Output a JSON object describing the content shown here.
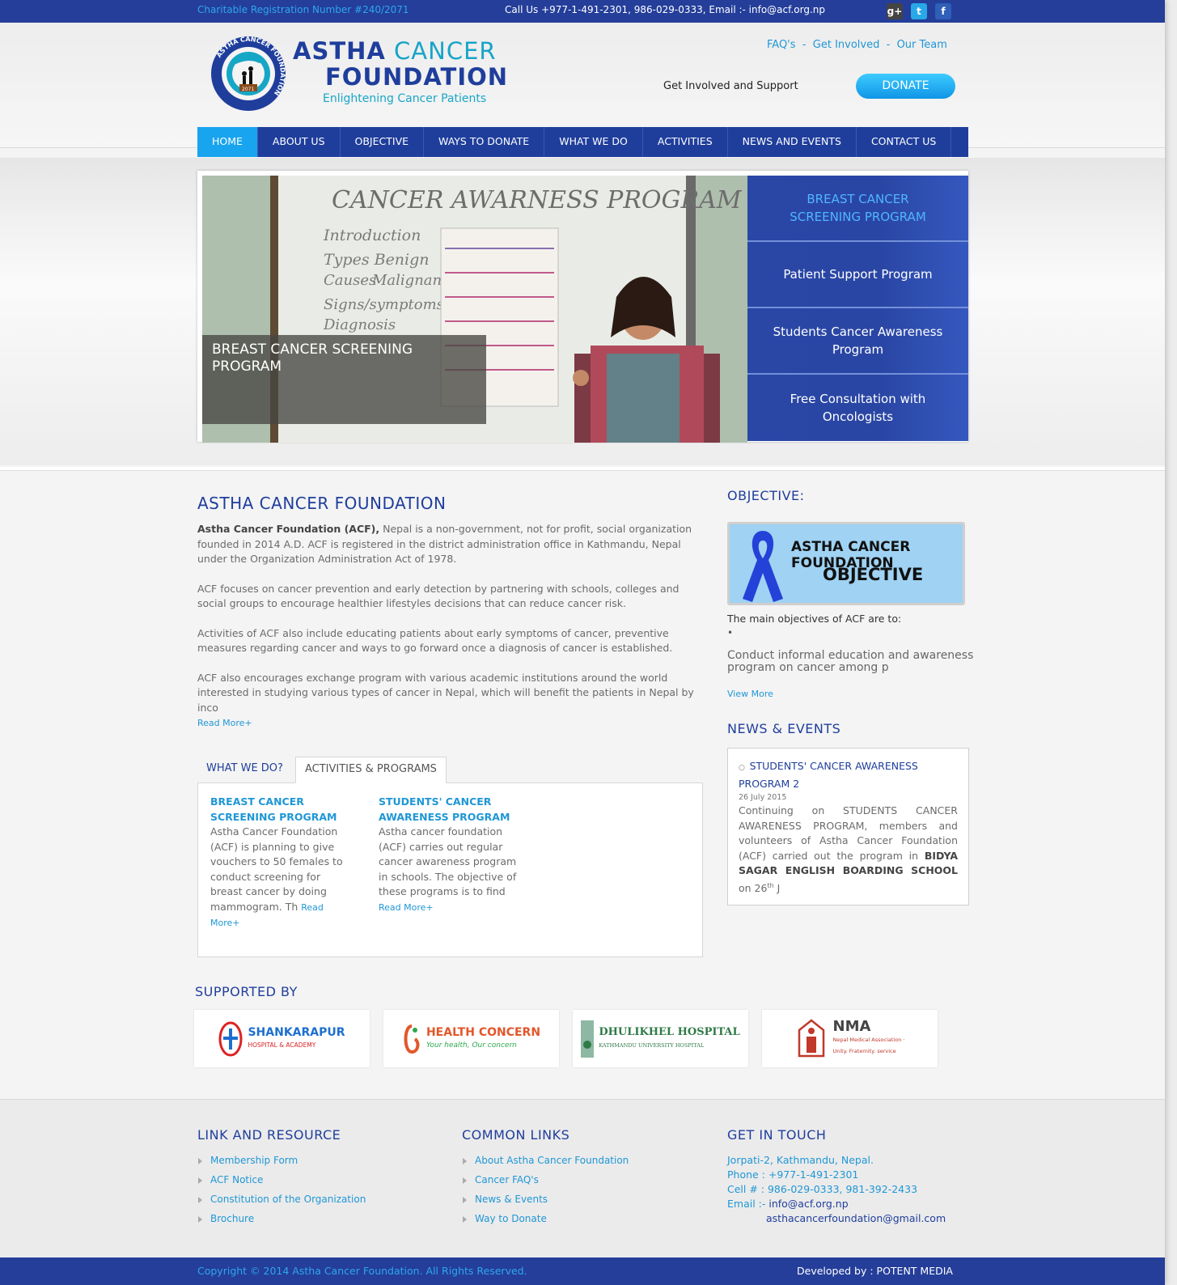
{
  "topbar": {
    "registration": "Charitable Registration Number #240/2071",
    "contact": "Call Us +977-1-491-2301, 986-029-0333, Email :- info@acf.org.np",
    "social": [
      "g+",
      "t",
      "f"
    ]
  },
  "brand": {
    "word1": "ASTHA",
    "word2": "CANCER",
    "word3": "FOUNDATION",
    "tagline": "Enlightening Cancer Patients",
    "logo_ring_text": "ASTHA CANCER FOUNDATION",
    "logo_year": "2071"
  },
  "header": {
    "links": [
      "FAQ's",
      "Get Involved",
      "Our Team"
    ],
    "separator": "-",
    "support_text": "Get Involved and Support",
    "donate_label": "DONATE"
  },
  "nav": {
    "items": [
      "HOME",
      "ABOUT US",
      "OBJECTIVE",
      "WAYS TO DONATE",
      "WHAT WE DO",
      "ACTIVITIES",
      "NEWS AND EVENTS",
      "CONTACT US"
    ]
  },
  "slider": {
    "caption": "BREAST CANCER SCREENING PROGRAM",
    "whiteboard_title": "CANCER AWARNESS PROGRAM",
    "whiteboard_lines": [
      "Introduction",
      "Types Benign",
      "Malignant",
      "Causes",
      "Signs/symptoms",
      "Diagnosis"
    ],
    "tabs": [
      "BREAST CANCER SCREENING PROGRAM",
      "Patient Support Program",
      "Students Cancer Awareness Program",
      "Free Consultation with Oncologists"
    ]
  },
  "about": {
    "title": "ASTHA CANCER FOUNDATION",
    "lead_bold": "Astha Cancer Foundation (ACF),",
    "p1": " Nepal is a non-government, not for profit, social organization founded in 2014 A.D. ACF is registered in the district administration office in Kathmandu, Nepal under the Organization Administration Act of 1978.",
    "p2": "ACF focuses on cancer prevention and early detection by partnering with schools, colleges and social groups to encourage healthier lifestyles decisions that can reduce cancer risk.",
    "p3": "Activities of ACF also include educating patients about early symptoms of cancer, preventive measures regarding cancer and ways to go forward once a diagnosis of cancer is established.",
    "p4": "ACF also encourages exchange program with various academic institutions around the world interested in studying various types of cancer in Nepal, which will benefit the patients in Nepal by inco",
    "read_more": "Read More+"
  },
  "tabs": {
    "tab1": "WHAT WE DO?",
    "tab2": "ACTIVITIES & PROGRAMS",
    "cards": [
      {
        "title": "BREAST CANCER SCREENING PROGRAM",
        "text": "Astha Cancer Foundation (ACF) is planning to give vouchers to 50 females to conduct screening for breast cancer by doing mammogram. Th ",
        "more": "Read More+"
      },
      {
        "title": "STUDENTS' CANCER AWARENESS PROGRAM",
        "text": "Astha cancer foundation (ACF) carries out regular cancer awareness program in schools. The objective of these programs is to find",
        "more": "Read More+"
      }
    ]
  },
  "objective": {
    "title": "OBJECTIVE:",
    "banner_line1": "ASTHA CANCER FOUNDATION",
    "banner_line2": "OBJECTIVE",
    "main": "The main objectives of ACF are to:",
    "bullet": "•",
    "text": "Conduct informal education and awareness program on cancer among p",
    "view_more": "View More"
  },
  "news": {
    "title": "NEWS & EVENTS",
    "item_title": "STUDENTS' CANCER AWARENESS PROGRAM 2",
    "date": "26 July 2015",
    "text_a": "Continuing on STUDENTS CANCER AWARENESS PROGRAM, members and volunteers of Astha Cancer Foundation (ACF) carried out the program in ",
    "text_bold": "BIDYA SAGAR ENGLISH BOARDING SCHOOL",
    "text_b": " on 26",
    "text_sup": "th",
    "text_c": " J"
  },
  "supported": {
    "title": "SUPPORTED BY",
    "sponsors": [
      {
        "name": "SHANKARAPUR",
        "sub": "HOSPITAL & ACADEMY",
        "color": "#1d6fcf"
      },
      {
        "name": "HEALTH CONCERN",
        "sub": "Your health, Our concern",
        "color": "#e2572a"
      },
      {
        "name": "DHULIKHEL HOSPITAL",
        "sub": "KATHMANDU UNIVERSITY HOSPITAL",
        "color": "#2f7a46"
      },
      {
        "name": "NMA",
        "sub": "Nepal Medical Association · Unity. Fraternity. service",
        "color": "#c0392b"
      }
    ]
  },
  "footer": {
    "col1_title": "LINK AND RESOURCE",
    "col1_links": [
      "Membership Form",
      "ACF Notice",
      "Constitution of the Organization",
      "Brochure"
    ],
    "col2_title": "COMMON LINKS",
    "col2_links": [
      "About Astha Cancer Foundation",
      "Cancer FAQ's",
      "News & Events",
      "Way to Donate"
    ],
    "col3_title": "GET IN TOUCH",
    "address": "Jorpati-2, Kathmandu, Nepal.",
    "phone": "Phone : +977-1-491-2301",
    "cell": "Cell # : 986-029-0333, 981-392-2433",
    "email_label": "Email :- ",
    "email1": "info@acf.org.np",
    "email2": "asthacancerfoundation@gmail.com",
    "copyright": "Copyright © 2014 Astha Cancer Foundation. All Rights Reserved.",
    "developer": "Developed by : POTENT MEDIA"
  },
  "colors": {
    "primary": "#1f3e9c",
    "accent": "#1f97d6",
    "nav_active": "#19a4ef"
  }
}
